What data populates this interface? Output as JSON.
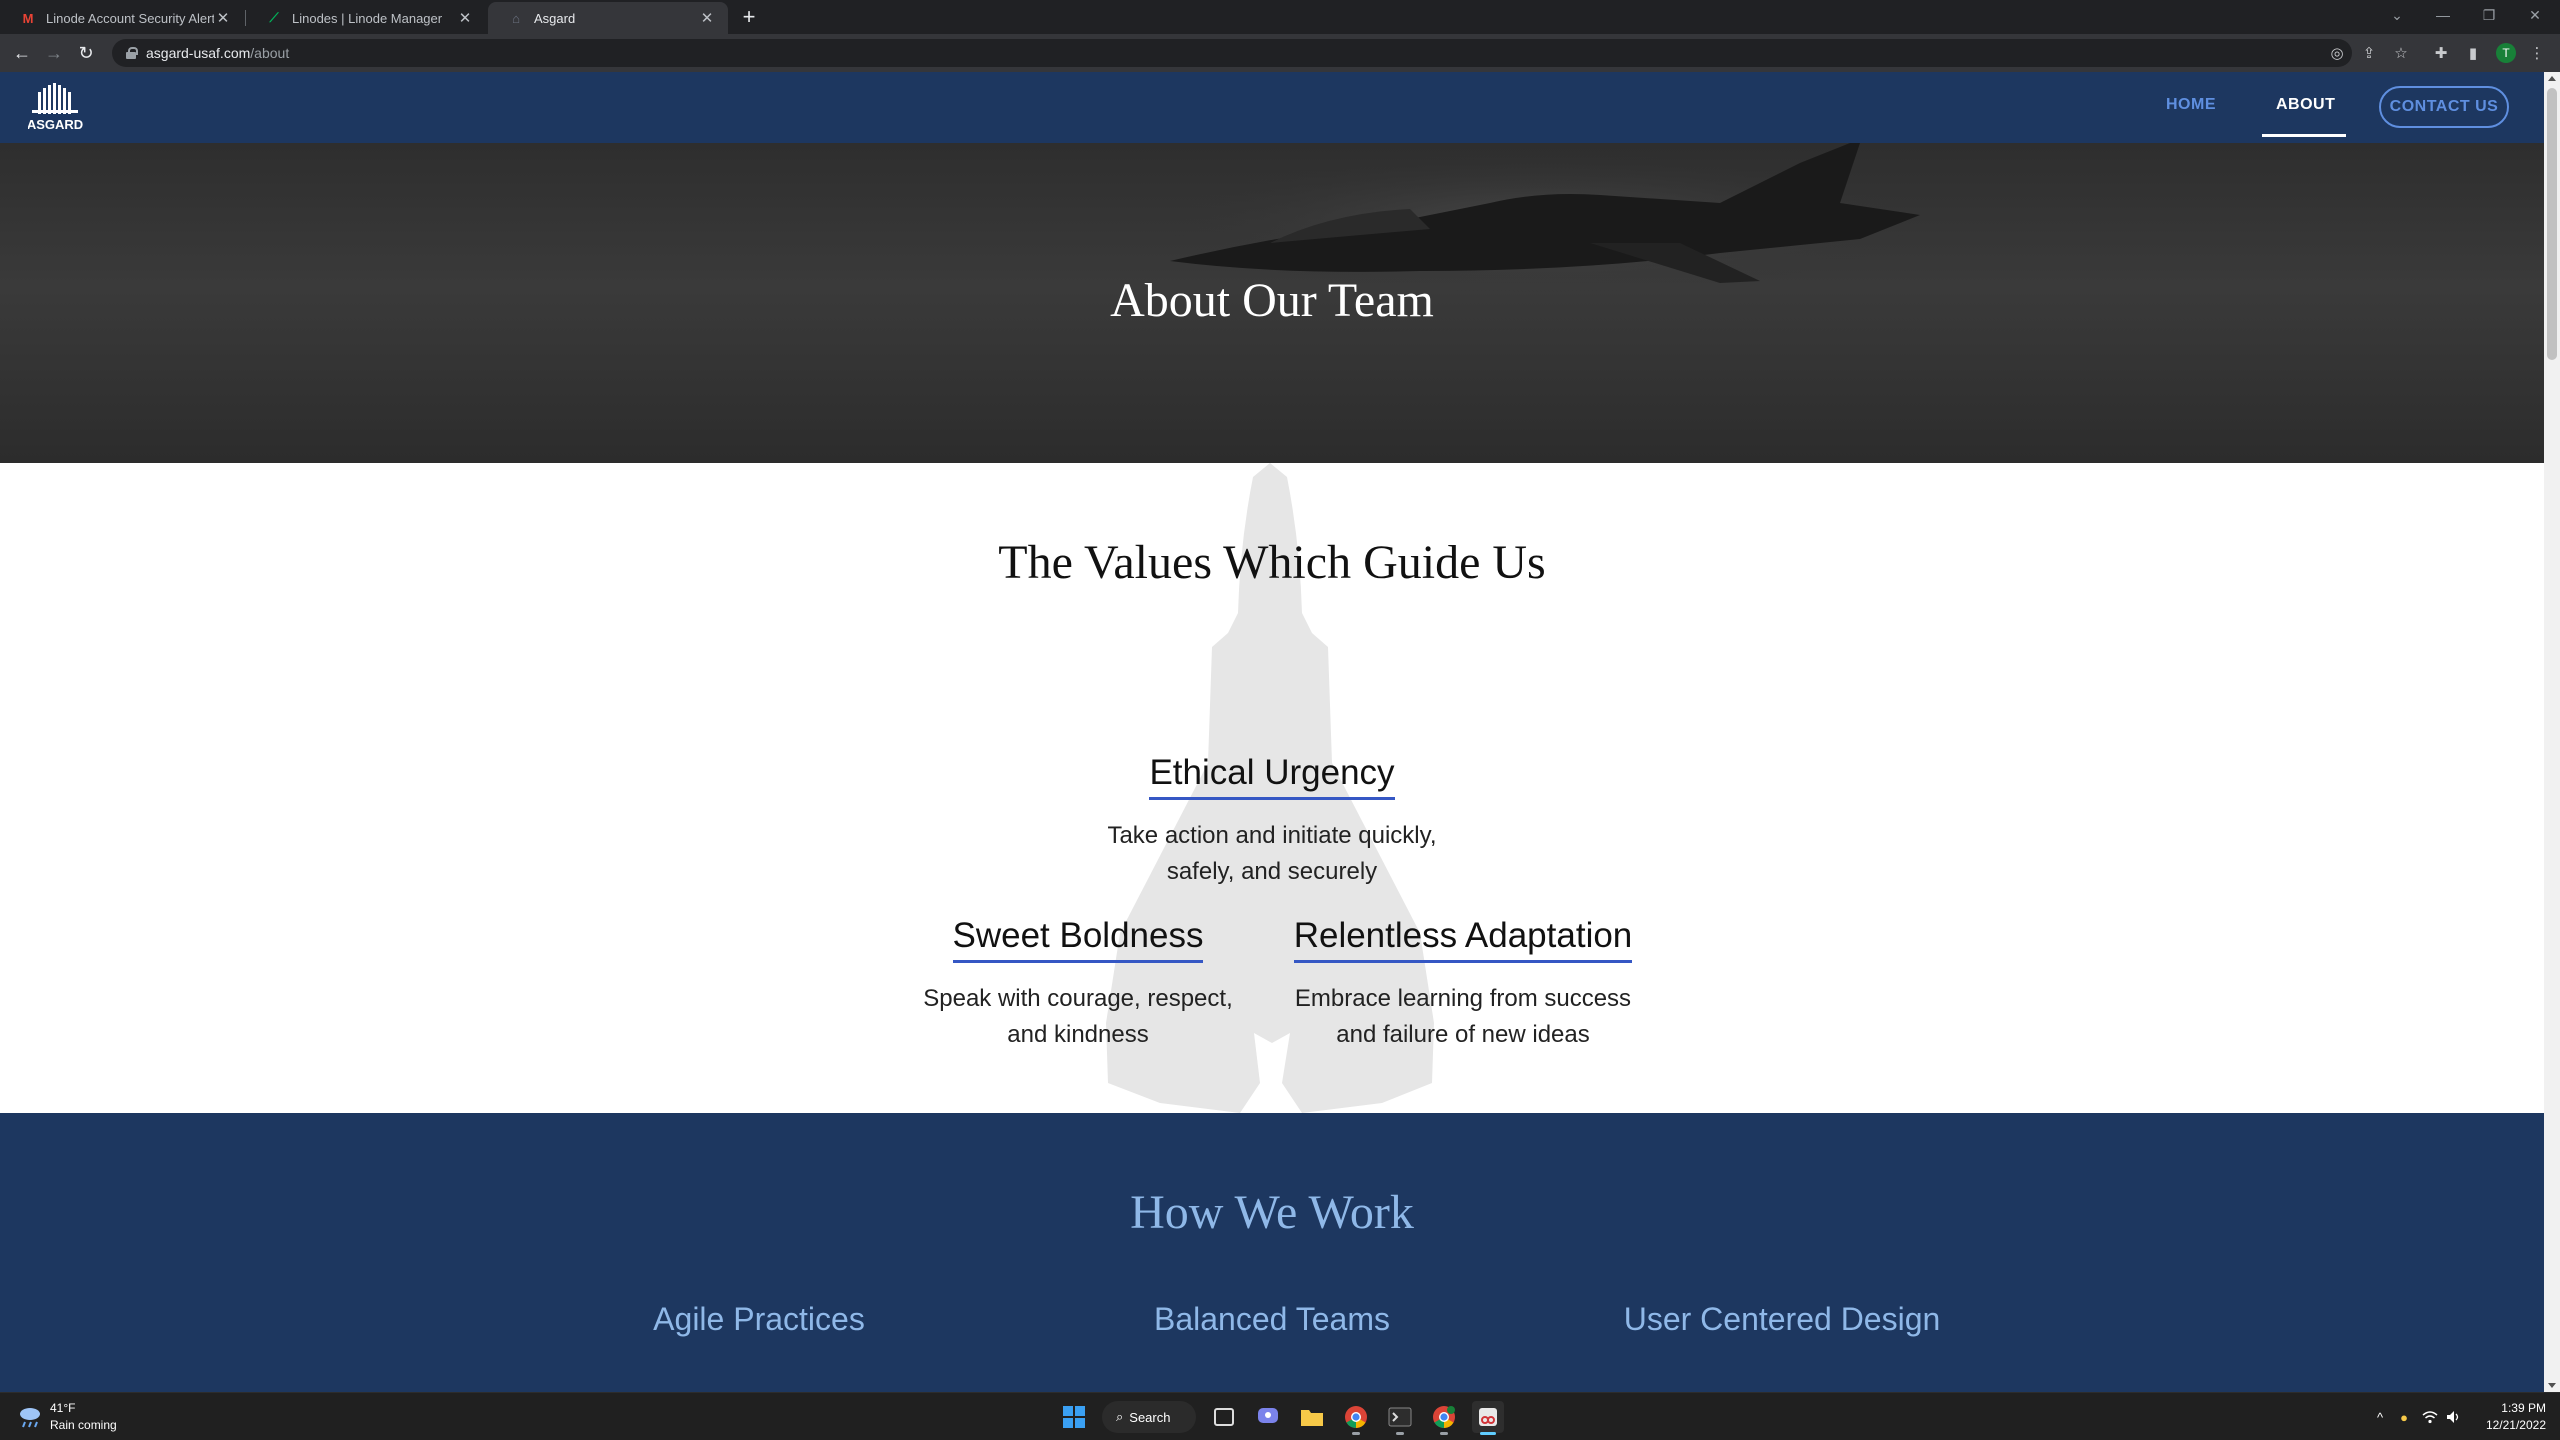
{
  "browser": {
    "tabs": [
      {
        "title": "Linode Account Security Alert - A",
        "icon": "gmail-icon"
      },
      {
        "title": "Linodes | Linode Manager",
        "icon": "linode-icon"
      },
      {
        "title": "Asgard",
        "icon": "asgard-favicon"
      }
    ],
    "active_tab": 2,
    "url_host": "asgard-usaf.com",
    "url_path": "/about",
    "profile_initial": "T"
  },
  "site": {
    "logo_text": "ASGARD",
    "nav": {
      "home": "HOME",
      "about": "ABOUT",
      "contact": "CONTACT US"
    },
    "hero_title": "About Our Team",
    "values": {
      "title": "The Values Which Guide Us",
      "items": [
        {
          "heading": "Ethical Urgency",
          "line1": "Take action and initiate quickly,",
          "line2": "safely, and securely"
        },
        {
          "heading": "Sweet Boldness",
          "line1": "Speak with courage, respect,",
          "line2": "and kindness"
        },
        {
          "heading": "Relentless Adaptation",
          "line1": "Embrace learning from success",
          "line2": "and failure of new ideas"
        }
      ]
    },
    "how_we_work": {
      "title": "How We Work",
      "items": [
        "Agile Practices",
        "Balanced Teams",
        "User Centered Design"
      ]
    },
    "colors": {
      "brand_navy": "#1d3760",
      "nav_link_blue": "#5f8fe0",
      "heading_underline": "#3557c4",
      "how_title_blue": "#8fb8e8"
    }
  },
  "taskbar": {
    "weather_temp": "41°F",
    "weather_desc": "Rain coming",
    "search_label": "Search",
    "time": "1:39 PM",
    "date": "12/21/2022"
  }
}
